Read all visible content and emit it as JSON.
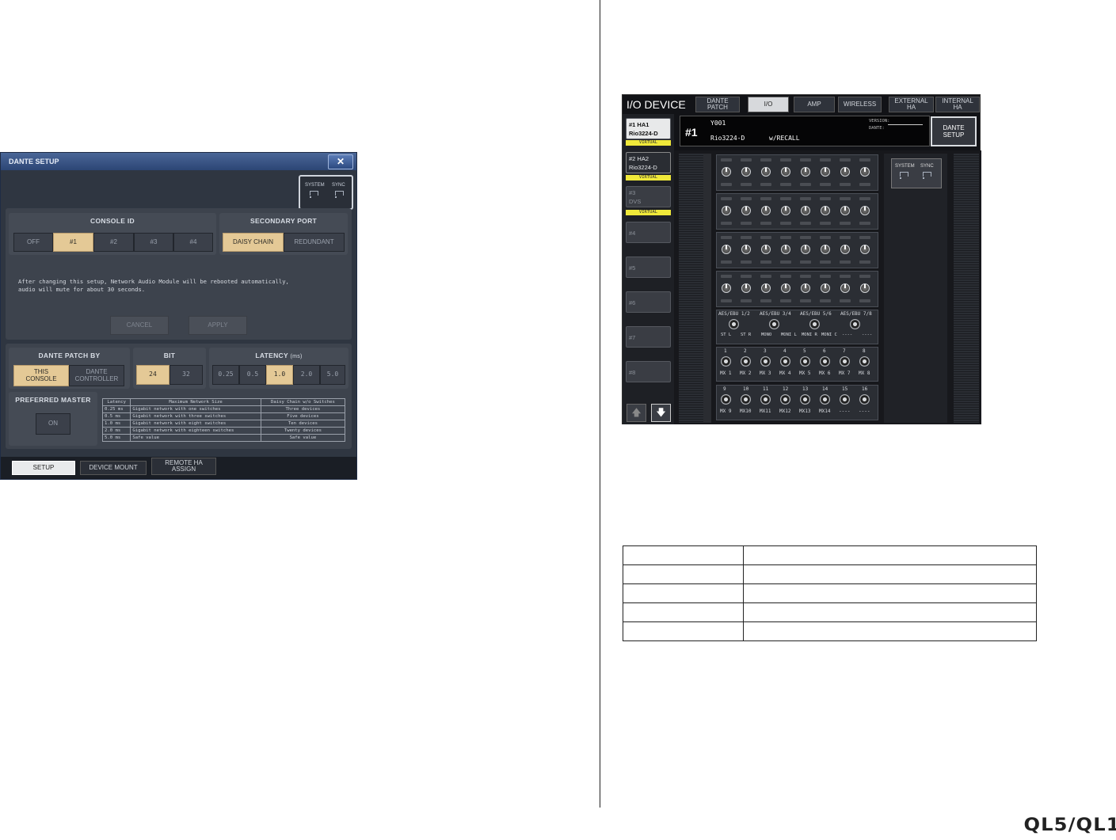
{
  "brand": {
    "model": "QL5/QL1"
  },
  "dante_setup": {
    "title": "DANTE SETUP",
    "close_label": "✕",
    "indicators": {
      "system": "SYSTEM",
      "sync": "SYNC"
    },
    "console_id": {
      "title": "CONSOLE ID",
      "options": [
        "OFF",
        "#1",
        "#2",
        "#3",
        "#4"
      ],
      "selected": "#1"
    },
    "secondary_port": {
      "title": "SECONDARY PORT",
      "options": [
        "DAISY CHAIN",
        "REDUNDANT"
      ],
      "selected": "DAISY CHAIN"
    },
    "message_line1": "After changing this setup, Network Audio Module will be rebooted automatically,",
    "message_line2": "audio will mute for about 30 seconds.",
    "cancel_label": "CANCEL",
    "apply_label": "APPLY",
    "dante_patch_by": {
      "title": "DANTE PATCH BY",
      "option1_line1": "THIS",
      "option1_line2": "CONSOLE",
      "option2_line1": "DANTE",
      "option2_line2": "CONTROLLER"
    },
    "bit": {
      "title": "BIT",
      "options": [
        "24",
        "32"
      ],
      "selected": "24"
    },
    "latency": {
      "title": "LATENCY",
      "unit": "(ms)",
      "options": [
        "0.25",
        "0.5",
        "1.0",
        "2.0",
        "5.0"
      ],
      "selected": "1.0"
    },
    "preferred_master": {
      "title": "PREFERRED MASTER",
      "button": "ON"
    },
    "latency_table": {
      "headers": [
        "Latency",
        "Maximum Network Size",
        "Daisy Chain w/o Switches"
      ],
      "rows": [
        [
          "0.25 ms",
          "Gigabit network with    one   switches",
          "Three devices"
        ],
        [
          "0.5  ms",
          "Gigabit network with   three  switches",
          "Five devices"
        ],
        [
          "1.0  ms",
          "Gigabit network with   eight  switches",
          "Ten devices"
        ],
        [
          "2.0  ms",
          "Gigabit network with eighteen switches",
          "Twenty devices"
        ],
        [
          "5.0  ms",
          "Safe value",
          "Safe value"
        ]
      ]
    },
    "tabs": {
      "setup": "SETUP",
      "device_mount": "DEVICE MOUNT",
      "remote_ha_line1": "REMOTE HA",
      "remote_ha_line2": "ASSIGN"
    }
  },
  "io_device": {
    "title": "I/O DEVICE",
    "tabs": {
      "dante_patch_l1": "DANTE",
      "dante_patch_l2": "PATCH",
      "io": "I/O",
      "amp": "AMP",
      "wireless": "WIRELESS",
      "ext_l1": "EXTERNAL",
      "ext_l2": "HA",
      "int_l1": "INTERNAL",
      "int_l2": "HA"
    },
    "slots": [
      {
        "l1": "#1 HA1",
        "l2": "Rio3224-D",
        "virtual": "VIRTUAL"
      },
      {
        "l1": "#2 HA2",
        "l2": "Rio3224-D",
        "virtual": "VIRTUAL"
      },
      {
        "l1": "#3",
        "l2": "DVS",
        "virtual": "VIRTUAL"
      },
      {
        "l1": "#4"
      },
      {
        "l1": "#5"
      },
      {
        "l1": "#6"
      },
      {
        "l1": "#7"
      },
      {
        "l1": "#8"
      }
    ],
    "info": {
      "id": "#1",
      "unit": "Y001",
      "model": "Rio3224-D",
      "recall": "w/RECALL",
      "version_label": "VERSION:",
      "dante_label": "DANTE:"
    },
    "dante_setup_btn_l1": "DANTE",
    "dante_setup_btn_l2": "SETUP",
    "indicators": {
      "system": "SYSTEM",
      "sync": "SYNC"
    },
    "aes_labels": [
      "AES/EBU 1/2",
      "AES/EBU 3/4",
      "AES/EBU 5/6",
      "AES/EBU 7/8"
    ],
    "aes_ch": [
      "ST L",
      "ST R",
      "MONO",
      "MONI L",
      "MONI R",
      "MONI C",
      "----",
      "----"
    ],
    "out_numbers_a": [
      "1",
      "2",
      "3",
      "4",
      "5",
      "6",
      "7",
      "8"
    ],
    "out_labels_a": [
      "MX 1",
      "MX 2",
      "MX 3",
      "MX 4",
      "MX 5",
      "MX 6",
      "MX 7",
      "MX 8"
    ],
    "out_numbers_b": [
      "9",
      "10",
      "11",
      "12",
      "13",
      "14",
      "15",
      "16"
    ],
    "out_labels_b": [
      "MX 9",
      "MX10",
      "MX11",
      "MX12",
      "MX13",
      "MX14",
      "----",
      "----"
    ]
  },
  "colors": {
    "selected_button": "#e4c996",
    "virtual_tag": "#f0e93a",
    "title_bar": "#2c4675"
  }
}
